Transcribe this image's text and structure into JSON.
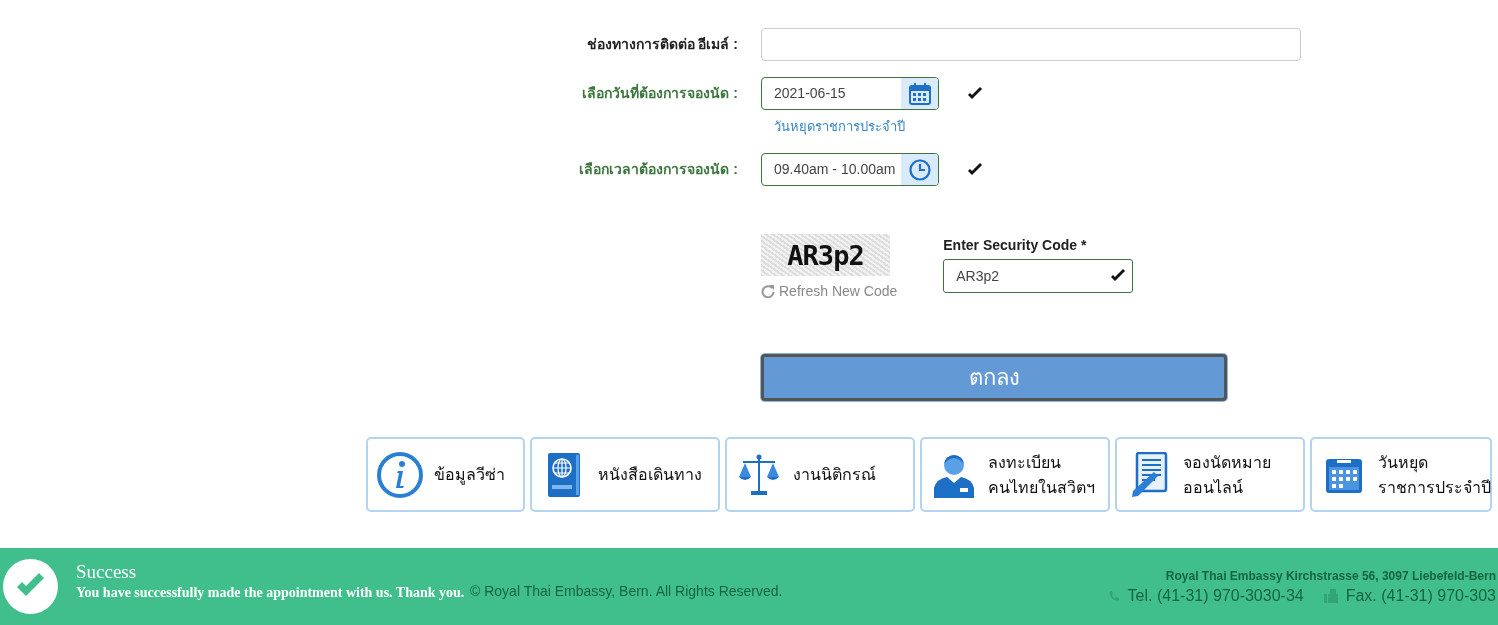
{
  "form": {
    "fields": [
      {
        "kind": "email",
        "label": "ช่องทางการติดต่อ อีเมล์ :",
        "valid": false
      },
      {
        "kind": "date",
        "label": "เลือกวันที่ต้องการจองนัด :",
        "value": "2021-06-15",
        "valid": true,
        "link": "วันหยุดราชการประจำปี"
      },
      {
        "kind": "time",
        "label": "เลือกเวลาต้องการจองนัด :",
        "value": "09.40am - 10.00am",
        "valid": true
      }
    ]
  },
  "captcha": {
    "image_text": "AR3p2",
    "refresh": "Refresh New Code",
    "label": "Enter Security Code",
    "required_mark": "*",
    "value": "AR3p2",
    "valid": true
  },
  "submit": "ตกลง",
  "tiles": [
    {
      "kind": "info",
      "lines": [
        "ข้อมูลวีซ่า"
      ]
    },
    {
      "kind": "passport",
      "lines": [
        "หนังสือเดินทาง"
      ]
    },
    {
      "kind": "scales",
      "lines": [
        "งานนิติกรณ์"
      ]
    },
    {
      "kind": "person",
      "lines": [
        "ลงทะเบียน",
        "คนไทยในสวิตฯ"
      ]
    },
    {
      "kind": "document",
      "lines": [
        "จองนัดหมาย",
        "ออนไลน์"
      ]
    },
    {
      "kind": "calendar",
      "lines": [
        "วันหยุด",
        "ราชการประจำปี"
      ]
    }
  ],
  "footer": {
    "copyright": "© Royal Thai Embassy, Bern. All Rights Reserved.",
    "address": "Royal Thai Embassy Kirchstrasse 56, 3097 Liebefeld-Bern",
    "tel": "Tel. (41-31) 970-3030-34",
    "fax": "Fax. (41-31) 970-303"
  },
  "toast": {
    "title": "Success",
    "message": "You have successfully made the appointment with us. Thank you."
  }
}
